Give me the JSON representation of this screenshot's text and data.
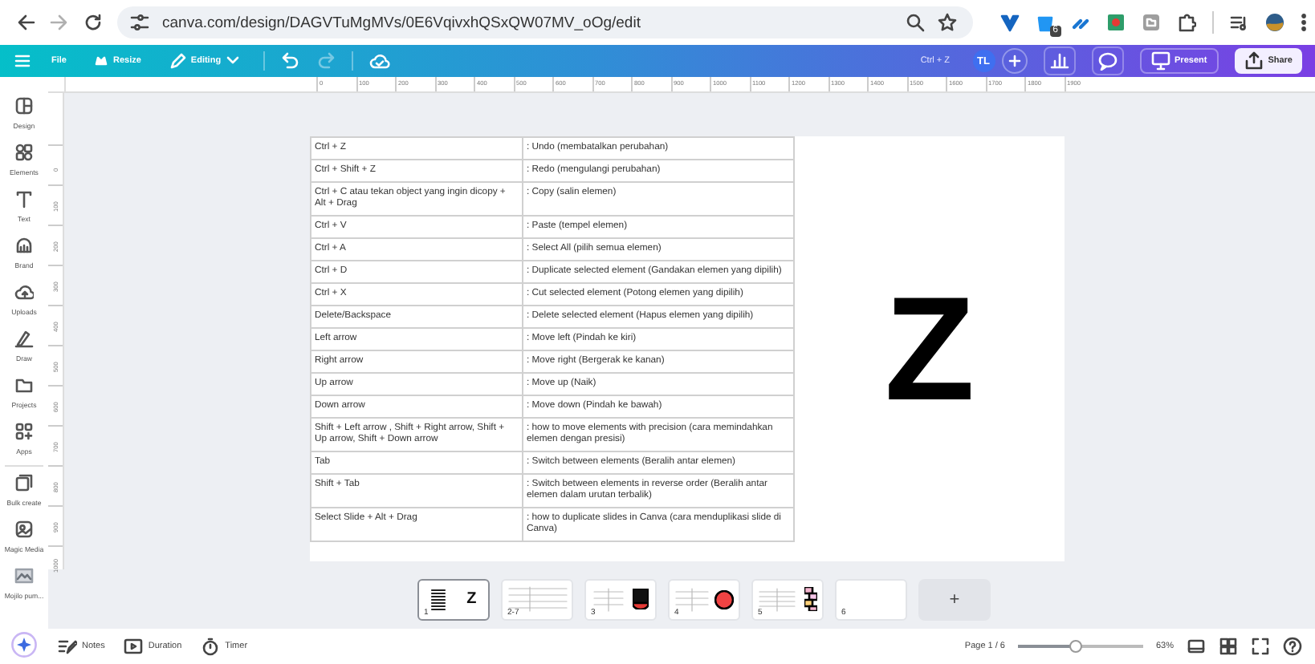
{
  "browser": {
    "url": "canva.com/design/DAGVTuMgMVs/0E6VqivxhQSxQW07MV_oOg/edit",
    "extension_badge": "6"
  },
  "toolbar": {
    "menu": [
      {
        "label": "File",
        "kind": "plain"
      },
      {
        "label": "Resize",
        "kind": "crown"
      },
      {
        "label": "Editing",
        "kind": "pencil"
      }
    ],
    "history": [
      {
        "kind": "undo",
        "disabled": false
      },
      {
        "kind": "redo",
        "disabled": true
      }
    ],
    "shortcut_hint": "Ctrl + Z",
    "avatar": "TL",
    "present": "Present",
    "share": "Share"
  },
  "ruler": {
    "horizontal": [
      "0",
      "100",
      "200",
      "300",
      "400",
      "500",
      "600",
      "700",
      "800",
      "900",
      "1000",
      "1100",
      "1200",
      "1300",
      "1400",
      "1500",
      "1600",
      "1700",
      "1800",
      "1900"
    ],
    "vertical": [
      "0",
      "100",
      "200",
      "300",
      "400",
      "500",
      "600",
      "700",
      "800",
      "900",
      "1000"
    ]
  },
  "sidebar": {
    "items": [
      {
        "label": "Design",
        "kind": "design"
      },
      {
        "label": "Elements",
        "kind": "elements"
      },
      {
        "label": "Text",
        "kind": "text"
      },
      {
        "label": "Brand",
        "kind": "brand"
      },
      {
        "label": "Uploads",
        "kind": "uploads"
      },
      {
        "label": "Draw",
        "kind": "draw"
      },
      {
        "label": "Projects",
        "kind": "projects"
      },
      {
        "label": "Apps",
        "kind": "apps"
      },
      {
        "label": "Bulk create",
        "kind": "bulk"
      },
      {
        "label": "Magic Media",
        "kind": "magic"
      },
      {
        "label": "Mojilo pum...",
        "kind": "image"
      }
    ]
  },
  "table": {
    "rows": [
      {
        "shortcut": "Ctrl + Z",
        "description": ": Undo (membatalkan perubahan)"
      },
      {
        "shortcut": "Ctrl + Shift + Z",
        "description": ": Redo (mengulangi perubahan)"
      },
      {
        "shortcut": "Ctrl + C atau tekan object yang ingin dicopy + Alt + Drag",
        "description": ": Copy (salin elemen)"
      },
      {
        "shortcut": "Ctrl + V",
        "description": ": Paste (tempel elemen)"
      },
      {
        "shortcut": "Ctrl + A",
        "description": ": Select All (pilih semua elemen)"
      },
      {
        "shortcut": "Ctrl + D",
        "description": ": Duplicate selected element (Gandakan elemen yang dipilih)"
      },
      {
        "shortcut": "Ctrl + X",
        "description": ": Cut selected element (Potong elemen yang dipilih)"
      },
      {
        "shortcut": "Delete/Backspace",
        "description": ": Delete selected element (Hapus elemen yang dipilih)"
      },
      {
        "shortcut": "Left arrow",
        "description": ": Move left (Pindah ke kiri)"
      },
      {
        "shortcut": "Right arrow",
        "description": ": Move right (Bergerak ke kanan)"
      },
      {
        "shortcut": "Up arrow",
        "description": ": Move up (Naik)"
      },
      {
        "shortcut": "Down arrow",
        "description": ": Move down (Pindah ke bawah)"
      },
      {
        "shortcut": "Shift + Left arrow , Shift + Right arrow, Shift + Up arrow, Shift + Down arrow",
        "description": ": how to move elements with precision (cara memindahkan elemen dengan presisi)"
      },
      {
        "shortcut": "Tab",
        "description": ": Switch between elements (Beralih antar elemen)"
      },
      {
        "shortcut": "Shift + Tab",
        "description": ": Switch between elements in reverse order (Beralih antar elemen dalam urutan terbalik)"
      },
      {
        "shortcut": "Select Slide + Alt + Drag",
        "description": ": how to duplicate slides in Canva (cara menduplikasi slide di Canva)"
      }
    ]
  },
  "slide_letter": "Z",
  "thumbnails": [
    {
      "label": "1",
      "selected": true,
      "letter": "Z",
      "kind": "letter"
    },
    {
      "label": "2-7",
      "selected": false,
      "kind": "table"
    },
    {
      "label": "3",
      "selected": false,
      "kind": "square"
    },
    {
      "label": "4",
      "selected": false,
      "kind": "dot"
    },
    {
      "label": "5",
      "selected": false,
      "kind": "stripes"
    },
    {
      "label": "6",
      "selected": false,
      "kind": "blank"
    }
  ],
  "add_page": "+",
  "footer": {
    "notes": "Notes",
    "duration": "Duration",
    "timer": "Timer",
    "page": "Page 1 / 6",
    "zoom": {
      "level": 0.46,
      "reading": "63%"
    }
  }
}
